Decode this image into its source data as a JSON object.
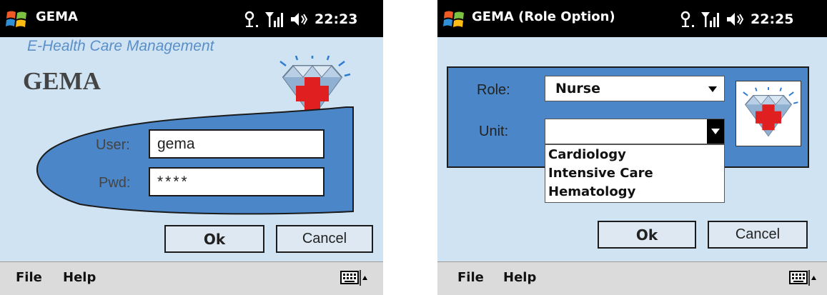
{
  "login_screen": {
    "title": "GEMA",
    "clock": "22:23",
    "subtitle": "E-Health Care Management",
    "app_name": "GEMA",
    "user_label": "User:",
    "user_value": "gema",
    "pwd_label": "Pwd:",
    "pwd_value": "****",
    "ok_label": "Ok",
    "cancel_label": "Cancel",
    "menu": {
      "file": "File",
      "help": "Help"
    }
  },
  "role_screen": {
    "title": "GEMA (Role Option)",
    "clock": "22:25",
    "role_label": "Role:",
    "role_value": "Nurse",
    "unit_label": "Unit:",
    "unit_value": "",
    "unit_options": [
      "Cardiology",
      "Intensive Care",
      "Hematology"
    ],
    "ok_label": "Ok",
    "cancel_label": "Cancel",
    "menu": {
      "file": "File",
      "help": "Help"
    }
  },
  "colors": {
    "panel_blue": "#4a86c8",
    "screen_bg": "#cfe3f3",
    "subtitle_blue": "#5a8fc8"
  },
  "icons": [
    "windows-start-icon",
    "antenna-icon",
    "signal-icon",
    "volume-icon",
    "keyboard-icon",
    "diamond-red-cross-logo"
  ]
}
